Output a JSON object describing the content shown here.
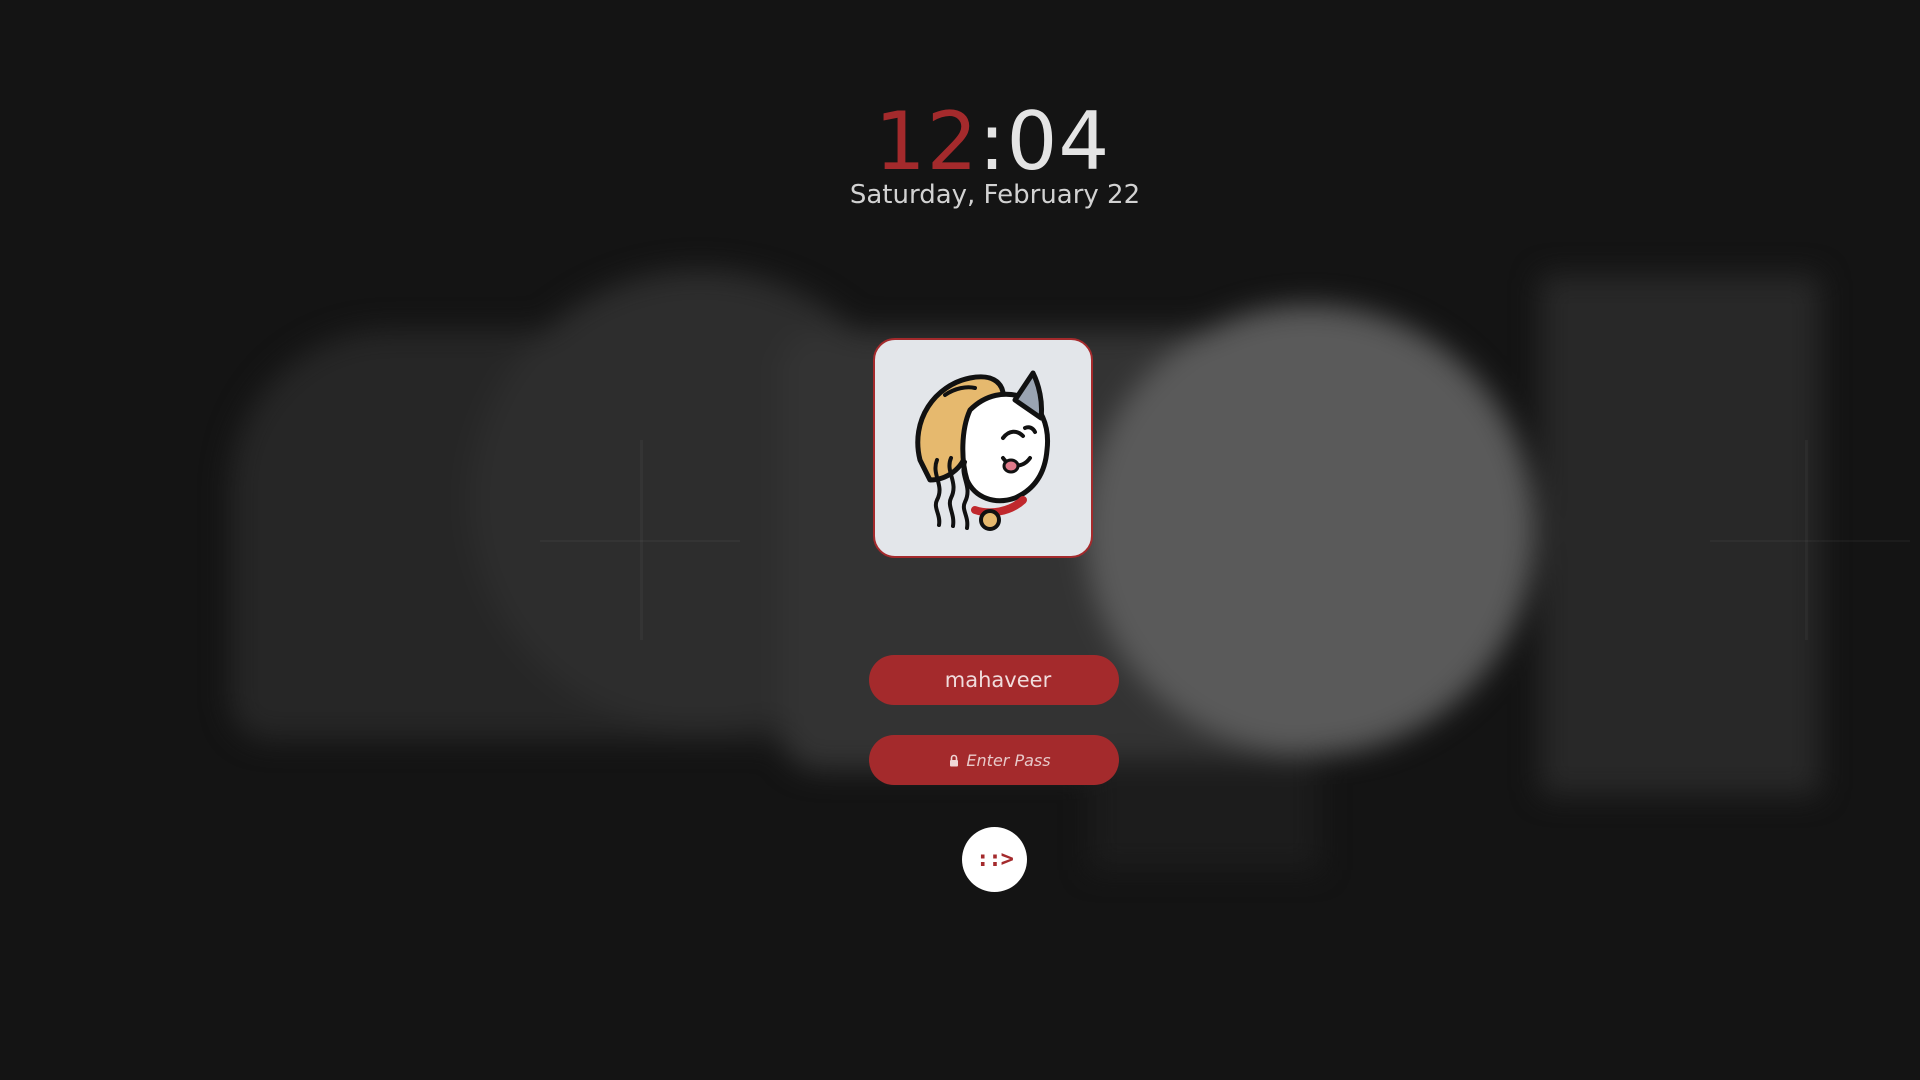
{
  "clock": {
    "hours": "12",
    "separator": ":",
    "minutes": "04"
  },
  "date": "Saturday, February 22",
  "avatar": {
    "icon": "cat-with-noodle-hat-avatar"
  },
  "user": {
    "name": "mahaveer"
  },
  "password": {
    "placeholder": "Enter Pass",
    "icon": "lock-icon"
  },
  "submit": {
    "label": "::>"
  },
  "colors": {
    "accent": "#a42a2c",
    "background": "#141414",
    "text": "#e4e4e4"
  }
}
